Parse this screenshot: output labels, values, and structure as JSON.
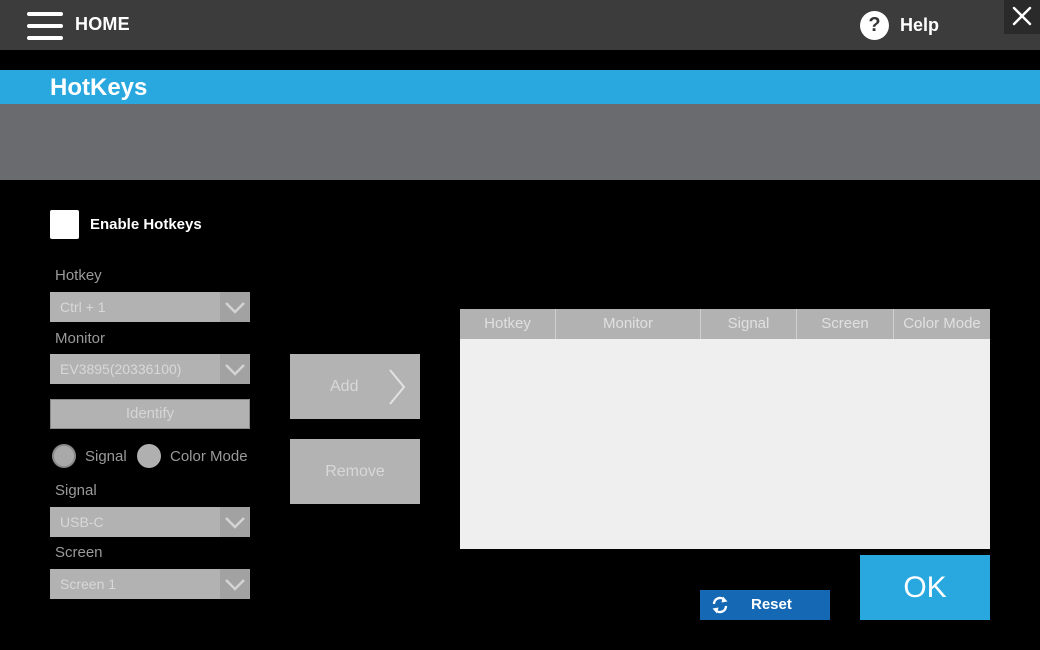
{
  "topbar": {
    "home_label": "HOME",
    "help_label": "Help",
    "menu_icon": "hamburger-menu-icon",
    "help_icon": "question-circle-icon",
    "close_icon": "close-icon"
  },
  "page": {
    "title": "HotKeys"
  },
  "enable": {
    "label": "Enable Hotkeys",
    "checked": false
  },
  "form": {
    "hotkey": {
      "label": "Hotkey",
      "value": "Ctrl + 1"
    },
    "monitor": {
      "label": "Monitor",
      "value": "EV3895(20336100)"
    },
    "identify_label": "Identify",
    "radios": [
      {
        "label": "Signal",
        "selected": false
      },
      {
        "label": "Color Mode",
        "selected": false
      }
    ],
    "signal": {
      "label": "Signal",
      "value": "USB-C"
    },
    "screen": {
      "label": "Screen",
      "value": "Screen 1"
    }
  },
  "actions": {
    "add_label": "Add",
    "remove_label": "Remove",
    "reset_label": "Reset",
    "ok_label": "OK"
  },
  "table": {
    "columns": [
      "Hotkey",
      "Monitor",
      "Signal",
      "Screen",
      "Color Mode"
    ],
    "rows": []
  },
  "colors": {
    "accent": "#29a8e0",
    "reset": "#1568b4",
    "topbar": "#3c3c3c",
    "band": "#6a6b6e"
  }
}
